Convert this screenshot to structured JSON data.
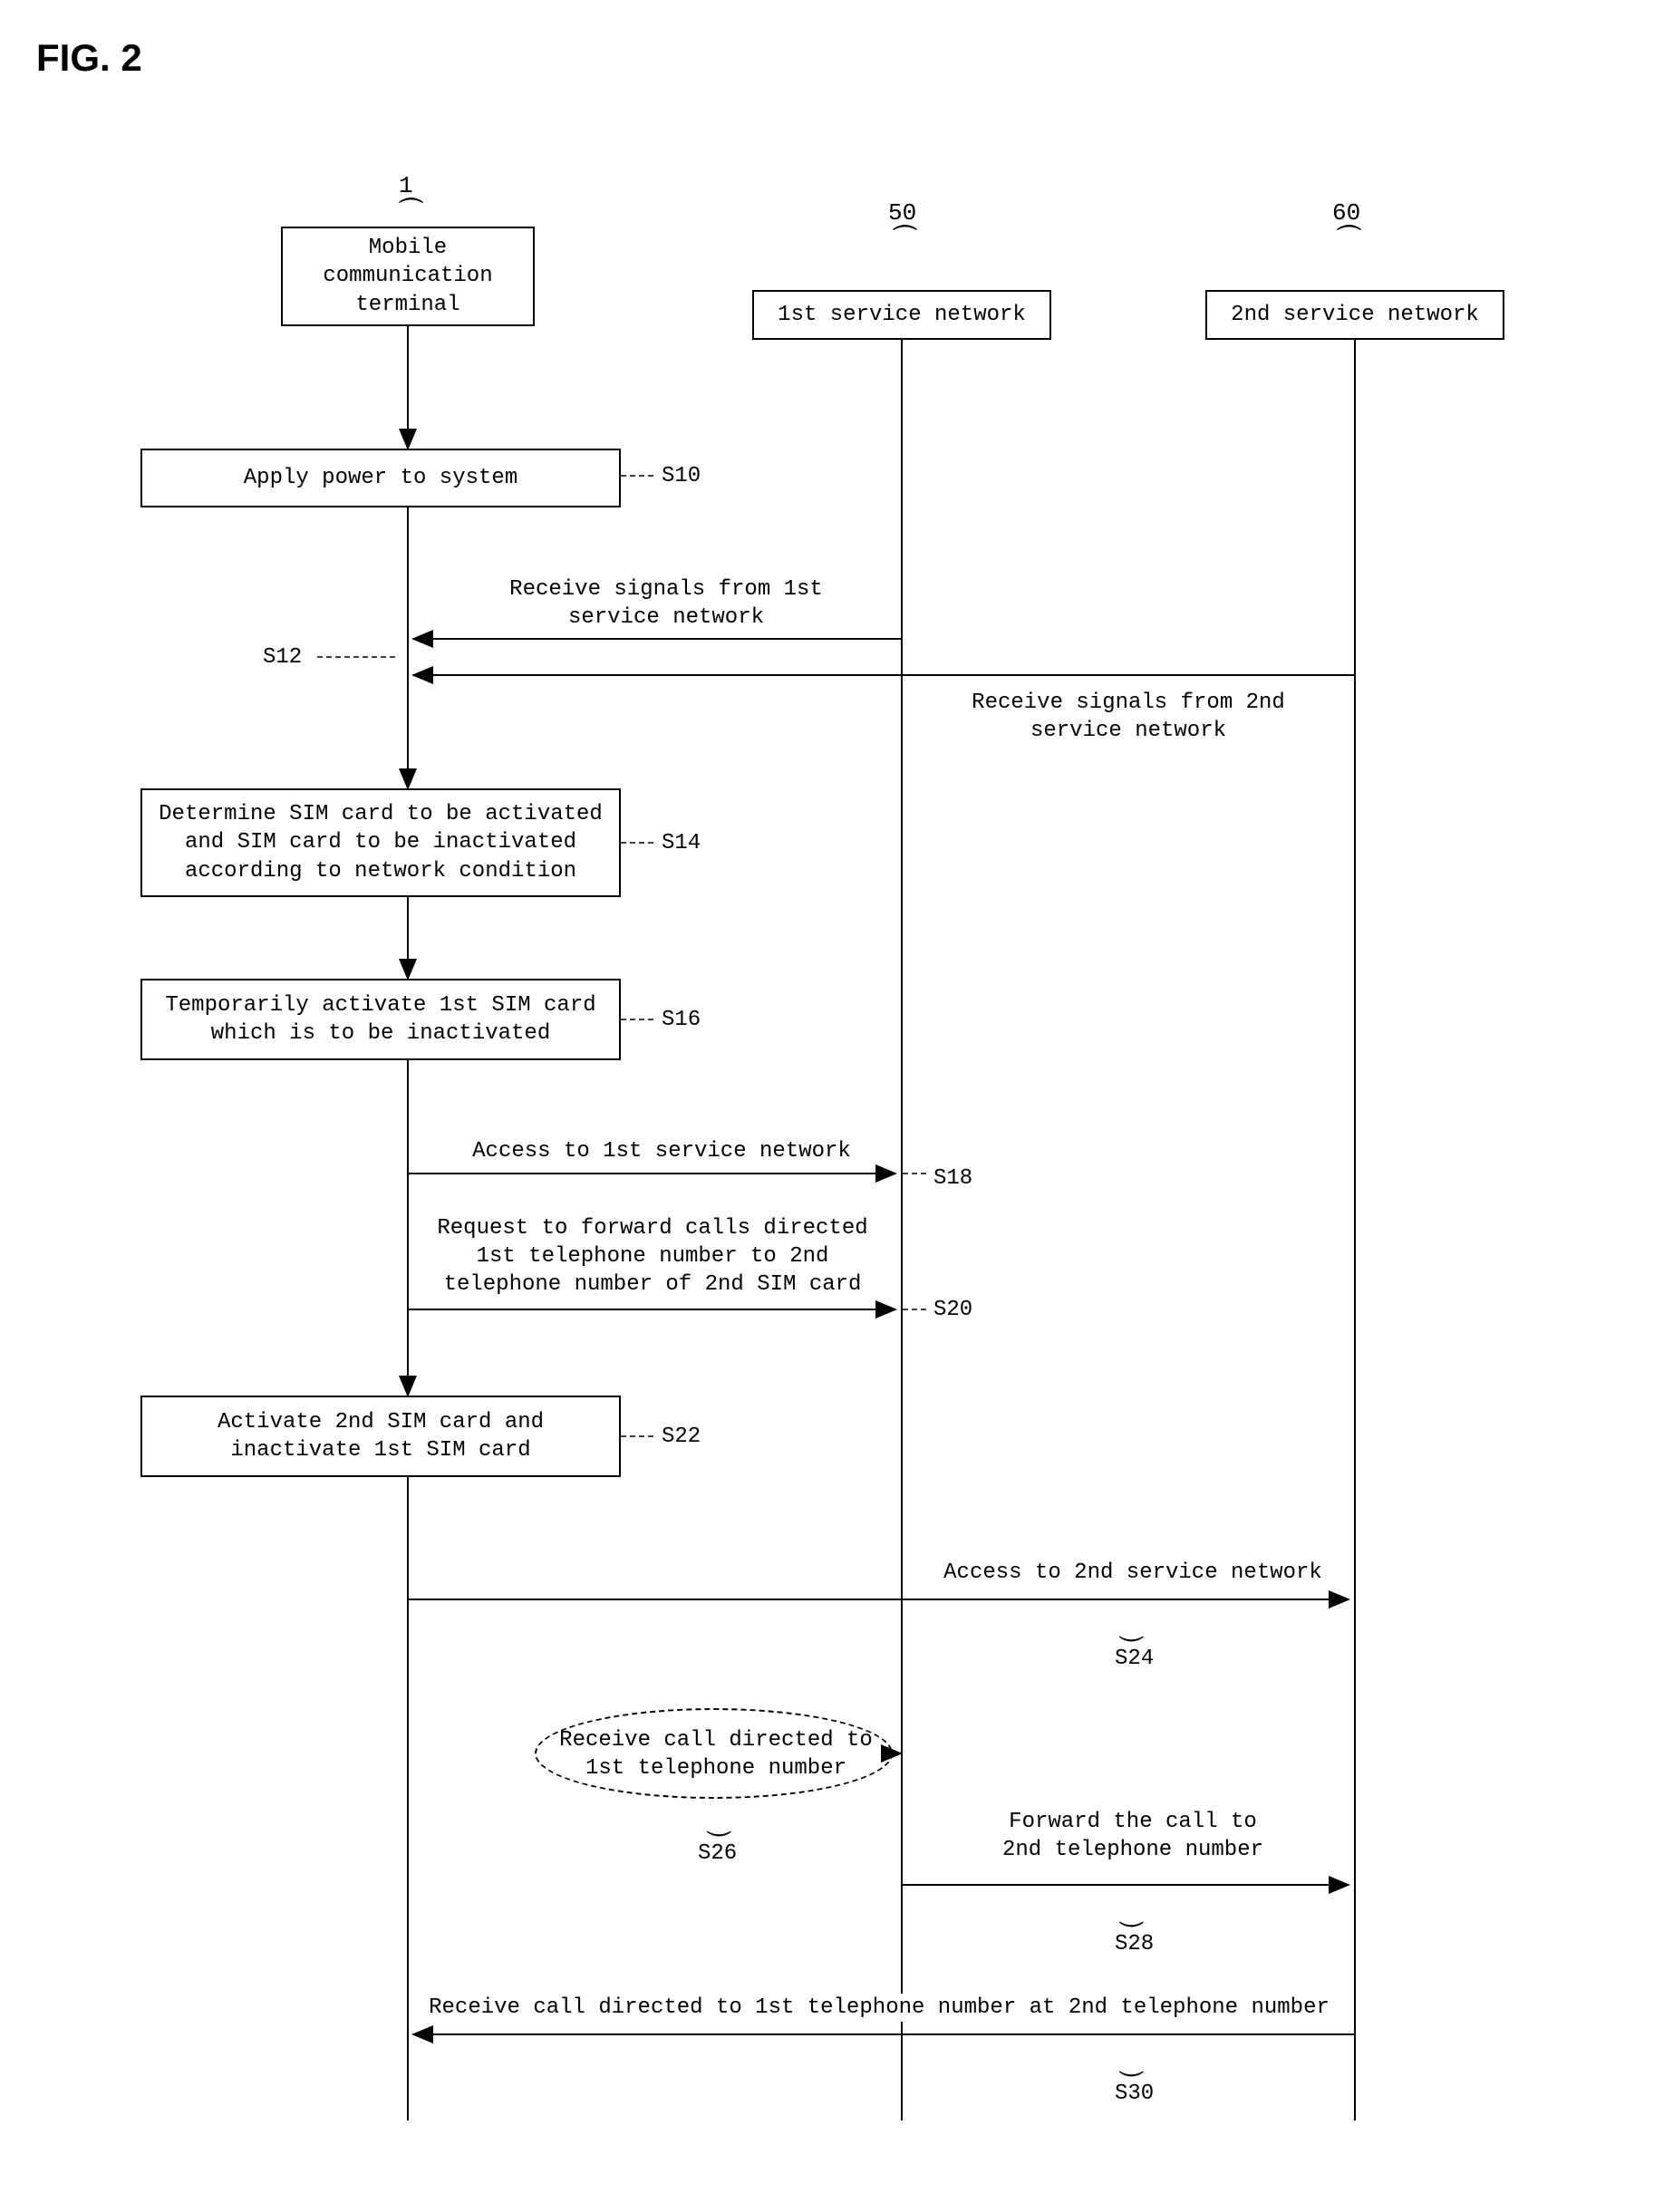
{
  "figure_label": "FIG. 2",
  "refs": {
    "terminal": "1",
    "net1": "50",
    "net2": "60"
  },
  "actors": {
    "terminal": "Mobile\ncommunication\nterminal",
    "net1": "1st service network",
    "net2": "2nd service network"
  },
  "steps": {
    "s10": {
      "tag": "S10",
      "text": "Apply power to system"
    },
    "s12": {
      "tag": "S12",
      "text": "Receive signals from 1st\nservice network",
      "text2": "Receive signals from 2nd\nservice network"
    },
    "s14": {
      "tag": "S14",
      "text": "Determine SIM card to be activated\nand SIM card to be inactivated\naccording to network condition"
    },
    "s16": {
      "tag": "S16",
      "text": "Temporarily activate 1st SIM card\nwhich is to be inactivated"
    },
    "s18": {
      "tag": "S18",
      "text": "Access to 1st service network"
    },
    "s20": {
      "tag": "S20",
      "text": "Request to forward calls directed\n1st telephone number to 2nd\ntelephone number of 2nd SIM card"
    },
    "s22": {
      "tag": "S22",
      "text": "Activate 2nd SIM card and\ninactivate 1st SIM card"
    },
    "s24": {
      "tag": "S24",
      "text": "Access to 2nd service network"
    },
    "s26": {
      "tag": "S26",
      "text": "Receive call directed to\n1st telephone number"
    },
    "s28": {
      "tag": "S28",
      "text": "Forward the call to\n2nd telephone number"
    },
    "s30": {
      "tag": "S30",
      "text": "Receive call directed to 1st telephone number at 2nd telephone number"
    }
  },
  "chart_data": {
    "type": "sequence",
    "actors": [
      {
        "id": "terminal",
        "label": "Mobile communication terminal",
        "ref": "1"
      },
      {
        "id": "net1",
        "label": "1st service network",
        "ref": "50"
      },
      {
        "id": "net2",
        "label": "2nd service network",
        "ref": "60"
      }
    ],
    "events": [
      {
        "id": "S10",
        "type": "box",
        "at": "terminal",
        "label": "Apply power to system"
      },
      {
        "id": "S12",
        "type": "message",
        "from": "net1",
        "to": "terminal",
        "label": "Receive signals from 1st service network"
      },
      {
        "id": "S12b",
        "type": "message",
        "from": "net2",
        "to": "terminal",
        "label": "Receive signals from 2nd service network"
      },
      {
        "id": "S14",
        "type": "box",
        "at": "terminal",
        "label": "Determine SIM card to be activated and SIM card to be inactivated according to network condition"
      },
      {
        "id": "S16",
        "type": "box",
        "at": "terminal",
        "label": "Temporarily activate 1st SIM card which is to be inactivated"
      },
      {
        "id": "S18",
        "type": "message",
        "from": "terminal",
        "to": "net1",
        "label": "Access to 1st service network"
      },
      {
        "id": "S20",
        "type": "message",
        "from": "terminal",
        "to": "net1",
        "label": "Request to forward calls directed 1st telephone number to 2nd telephone number of 2nd SIM card"
      },
      {
        "id": "S22",
        "type": "box",
        "at": "terminal",
        "label": "Activate 2nd SIM card and inactivate 1st SIM card"
      },
      {
        "id": "S24",
        "type": "message",
        "from": "terminal",
        "to": "net2",
        "label": "Access to 2nd service network"
      },
      {
        "id": "S26",
        "type": "event",
        "at": "net1",
        "label": "Receive call directed to 1st telephone number",
        "style": "dashed-ellipse"
      },
      {
        "id": "S28",
        "type": "message",
        "from": "net1",
        "to": "net2",
        "label": "Forward the call to 2nd telephone number"
      },
      {
        "id": "S30",
        "type": "message",
        "from": "net2",
        "to": "terminal",
        "label": "Receive call directed to 1st telephone number at 2nd telephone number"
      }
    ]
  }
}
